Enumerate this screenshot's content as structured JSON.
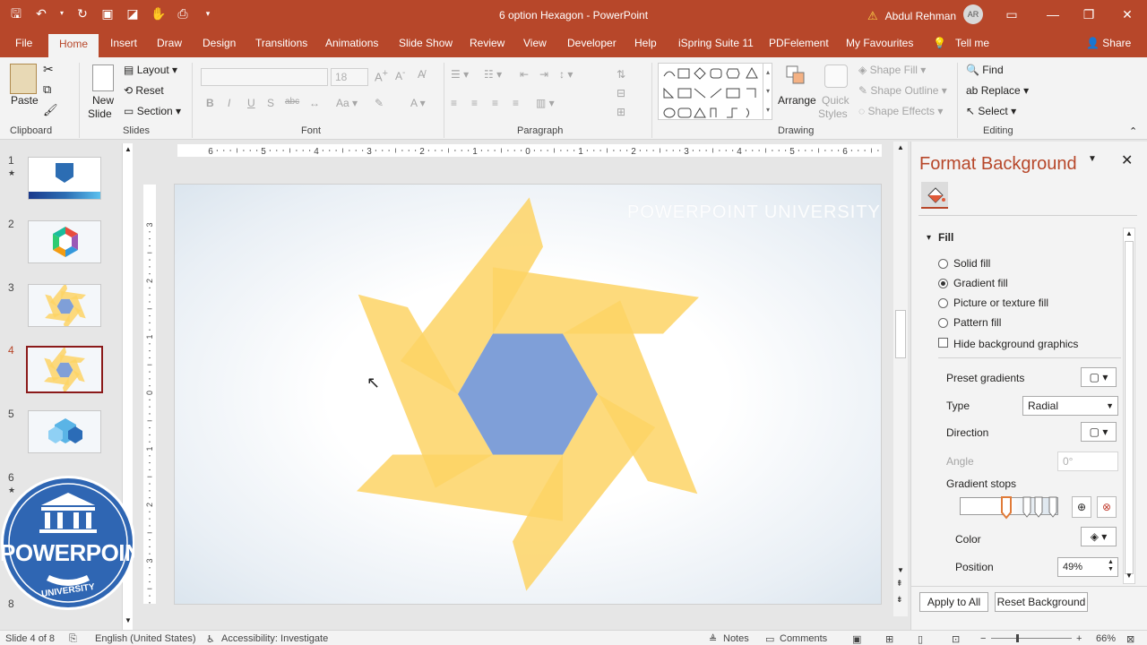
{
  "window": {
    "title": "6 option Hexagon  -  PowerPoint",
    "user_name": "Abdul Rehman",
    "user_initials": "AR"
  },
  "tabs": [
    "File",
    "Home",
    "Insert",
    "Draw",
    "Design",
    "Transitions",
    "Animations",
    "Slide Show",
    "Review",
    "View",
    "Developer",
    "Help",
    "iSpring Suite 11",
    "PDFelement",
    "My Favourites",
    "Tell me",
    "Share"
  ],
  "ribbon": {
    "clipboard": {
      "paste": "Paste",
      "label": "Clipboard"
    },
    "slides": {
      "new_slide": "New",
      "new_slide2": "Slide",
      "layout": "Layout",
      "reset": "Reset",
      "section": "Section",
      "label": "Slides"
    },
    "font": {
      "label": "Font",
      "size": "18"
    },
    "paragraph": {
      "label": "Paragraph"
    },
    "drawing": {
      "arrange": "Arrange",
      "quick": "Quick",
      "styles": "Styles",
      "shape_fill": "Shape Fill",
      "shape_outline": "Shape Outline",
      "shape_effects": "Shape Effects",
      "label": "Drawing"
    },
    "editing": {
      "find": "Find",
      "replace": "Replace",
      "select": "Select",
      "label": "Editing"
    }
  },
  "thumbnails": [
    {
      "num": "1",
      "star": "★"
    },
    {
      "num": "2",
      "star": ""
    },
    {
      "num": "3",
      "star": ""
    },
    {
      "num": "4",
      "star": ""
    },
    {
      "num": "5",
      "star": ""
    },
    {
      "num": "6",
      "star": "★"
    },
    {
      "num": "8",
      "star": ""
    }
  ],
  "ruler": {
    "h_labels": [
      "6",
      "5",
      "4",
      "3",
      "2",
      "1",
      "0",
      "1",
      "2",
      "3",
      "4",
      "5",
      "6"
    ],
    "v_labels": [
      "3",
      "2",
      "1",
      "0",
      "1",
      "2",
      "3"
    ]
  },
  "slide": {
    "watermark": "POWERPOINT UNIVERSITY",
    "colors": {
      "petal": "#fdd365",
      "hexagon": "#7f9fd8"
    }
  },
  "logo": {
    "line1": "POWERPOINT",
    "line2": "UNIVERSITY"
  },
  "panel": {
    "title": "Format Background",
    "section": "Fill",
    "options": [
      "Solid fill",
      "Gradient fill",
      "Picture or texture fill",
      "Pattern fill"
    ],
    "selected": "Gradient fill",
    "hide_bg": "Hide background graphics",
    "preset": "Preset gradients",
    "type_label": "Type",
    "type_value": "Radial",
    "direction": "Direction",
    "angle": "Angle",
    "angle_value": "0°",
    "stops": "Gradient stops",
    "color": "Color",
    "position": "Position",
    "position_value": "49%",
    "apply_all": "Apply to All",
    "reset_bg": "Reset Background"
  },
  "status": {
    "slide": "Slide 4 of 8",
    "language": "English (United States)",
    "accessibility": "Accessibility: Investigate",
    "notes": "Notes",
    "comments": "Comments",
    "zoom": "66%"
  },
  "colors": {
    "accent": "#b7472a",
    "panel_title": "#b7472a"
  }
}
